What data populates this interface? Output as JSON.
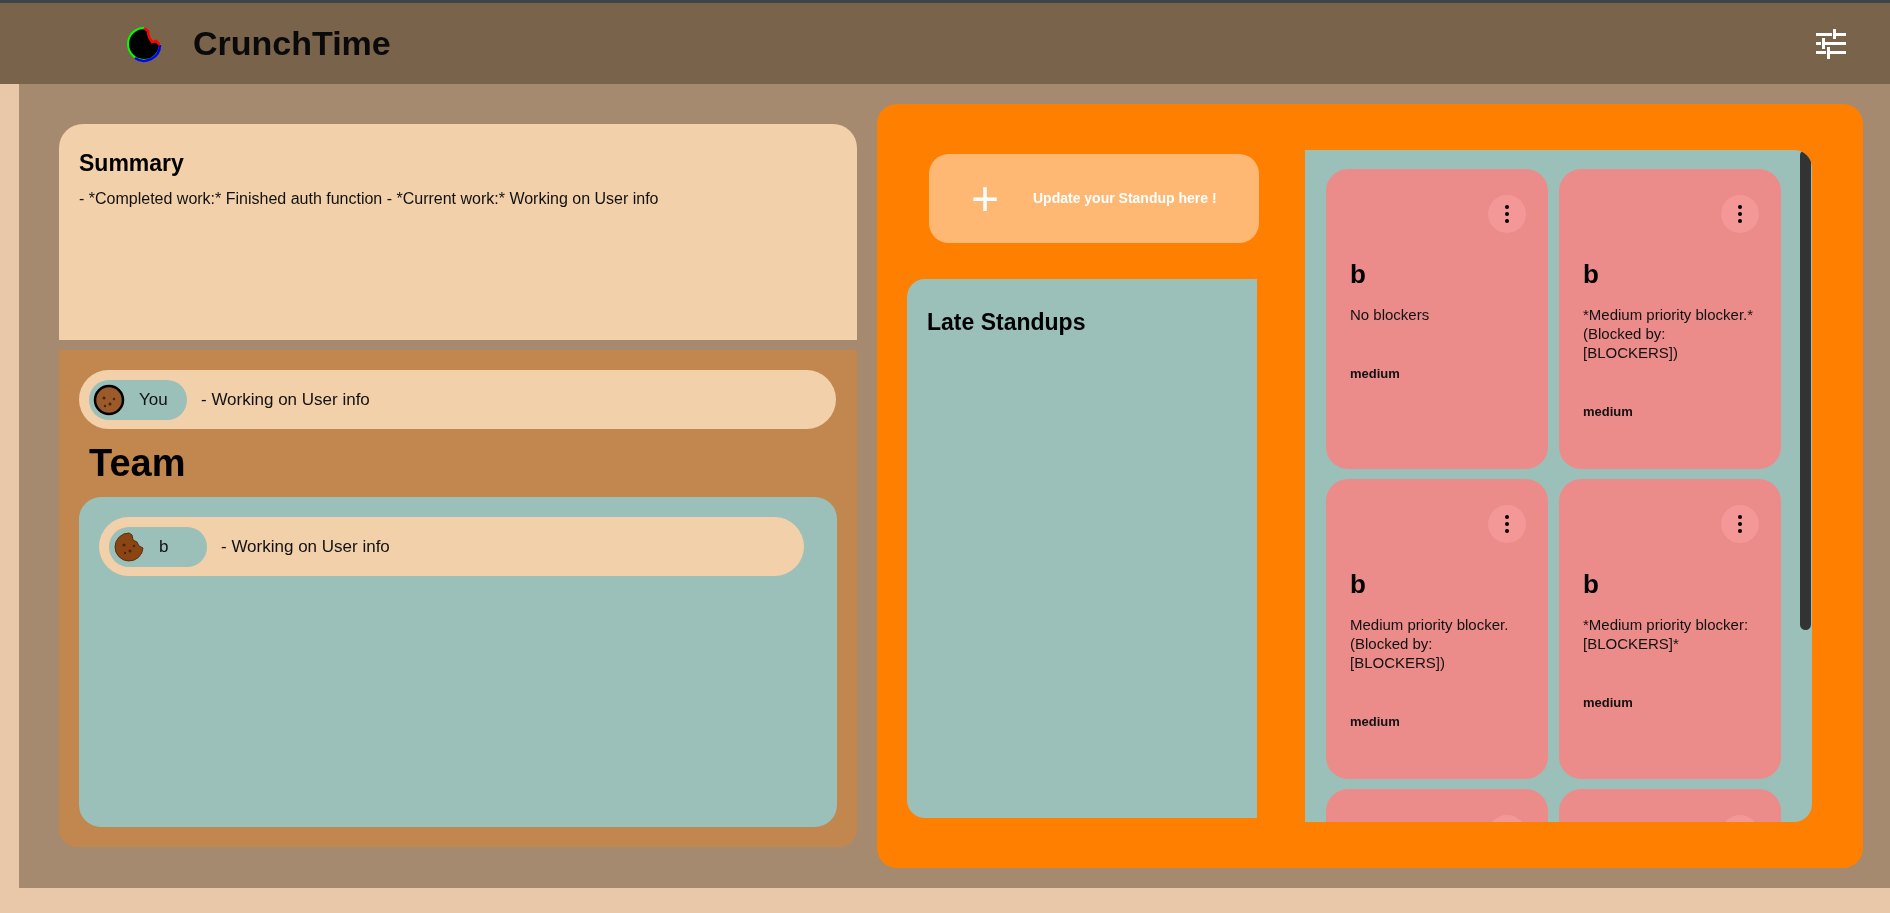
{
  "header": {
    "title": "CrunchTime"
  },
  "summary": {
    "title": "Summary",
    "text": "- *Completed work:* Finished auth function - *Current work:* Working on User info"
  },
  "you": {
    "name": "You",
    "status": "- Working on User info"
  },
  "team": {
    "title": "Team",
    "members": [
      {
        "name": "b",
        "status": "- Working on User info"
      }
    ]
  },
  "update_button": {
    "plus": "+",
    "label": "Update your Standup here !"
  },
  "late_standups": {
    "title": "Late Standups"
  },
  "cards": [
    {
      "kind": "card",
      "name": "b",
      "text": "No blockers",
      "priority": "medium"
    },
    {
      "kind": "card",
      "name": "b",
      "text": "*Medium priority blocker.* (Blocked by: [BLOCKERS])",
      "priority": "medium"
    },
    {
      "kind": "card",
      "name": "b",
      "text": "Medium priority blocker. (Blocked by: [BLOCKERS])",
      "priority": "medium"
    },
    {
      "kind": "card",
      "name": "b",
      "text": "*Medium priority blocker: [BLOCKERS]*",
      "priority": "medium"
    },
    {
      "kind": "partial"
    },
    {
      "kind": "partial"
    }
  ]
}
